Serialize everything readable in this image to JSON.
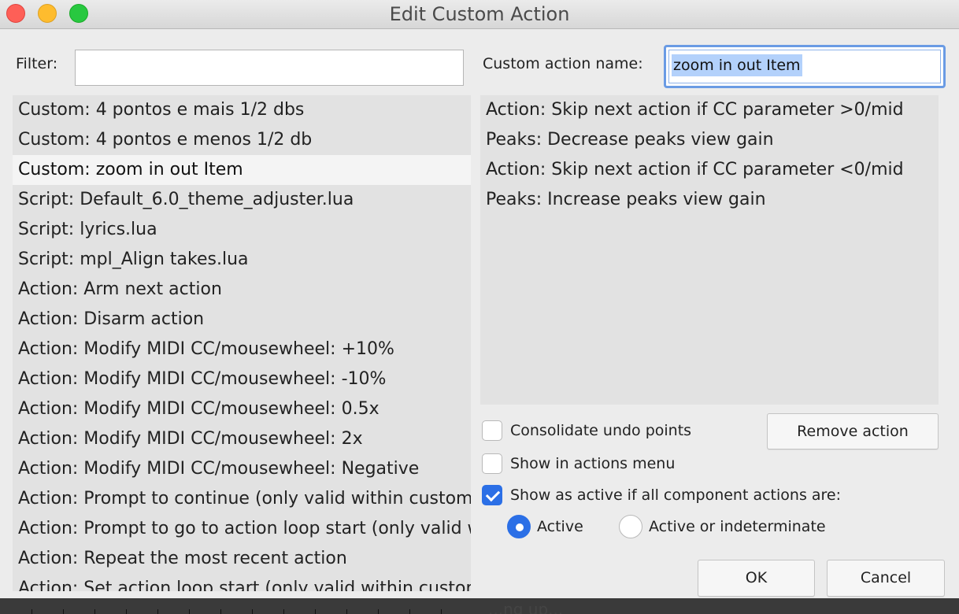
{
  "window": {
    "title": "Edit Custom Action"
  },
  "filter": {
    "label": "Filter:",
    "value": ""
  },
  "custom_name": {
    "label": "Custom action name:",
    "value": "zoom in out Item"
  },
  "left_list": [
    "Custom: 4 pontos e mais 1/2 dbs",
    "Custom: 4 pontos e menos 1/2 db",
    "Custom: zoom in out Item",
    "Script: Default_6.0_theme_adjuster.lua",
    "Script: lyrics.lua",
    "Script: mpl_Align takes.lua",
    "Action: Arm next action",
    "Action: Disarm action",
    "Action: Modify MIDI CC/mousewheel: +10%",
    "Action: Modify MIDI CC/mousewheel: -10%",
    "Action: Modify MIDI CC/mousewheel: 0.5x",
    "Action: Modify MIDI CC/mousewheel: 2x",
    "Action: Modify MIDI CC/mousewheel: Negative",
    "Action: Prompt to continue (only valid within custom actions)",
    "Action: Prompt to go to action loop start (only valid within custom actions)",
    "Action: Repeat the most recent action",
    "Action: Set action loop start (only valid within custom actions)"
  ],
  "left_selected_index": 2,
  "right_list": [
    "Action: Skip next action if CC parameter >0/mid",
    "Peaks: Decrease peaks view gain",
    "Action: Skip next action if CC parameter <0/mid",
    "Peaks: Increase peaks view gain"
  ],
  "options": {
    "consolidate": {
      "label": "Consolidate undo points",
      "checked": false
    },
    "show_menu": {
      "label": "Show in actions menu",
      "checked": false
    },
    "show_active": {
      "label": "Show as active if all component actions are:",
      "checked": true
    }
  },
  "radios": {
    "active": {
      "label": "Active",
      "selected": true
    },
    "indeterminate": {
      "label": "Active or indeterminate",
      "selected": false
    }
  },
  "buttons": {
    "remove": "Remove action",
    "ok": "OK",
    "cancel": "Cancel"
  },
  "background_text": "...ng up..."
}
